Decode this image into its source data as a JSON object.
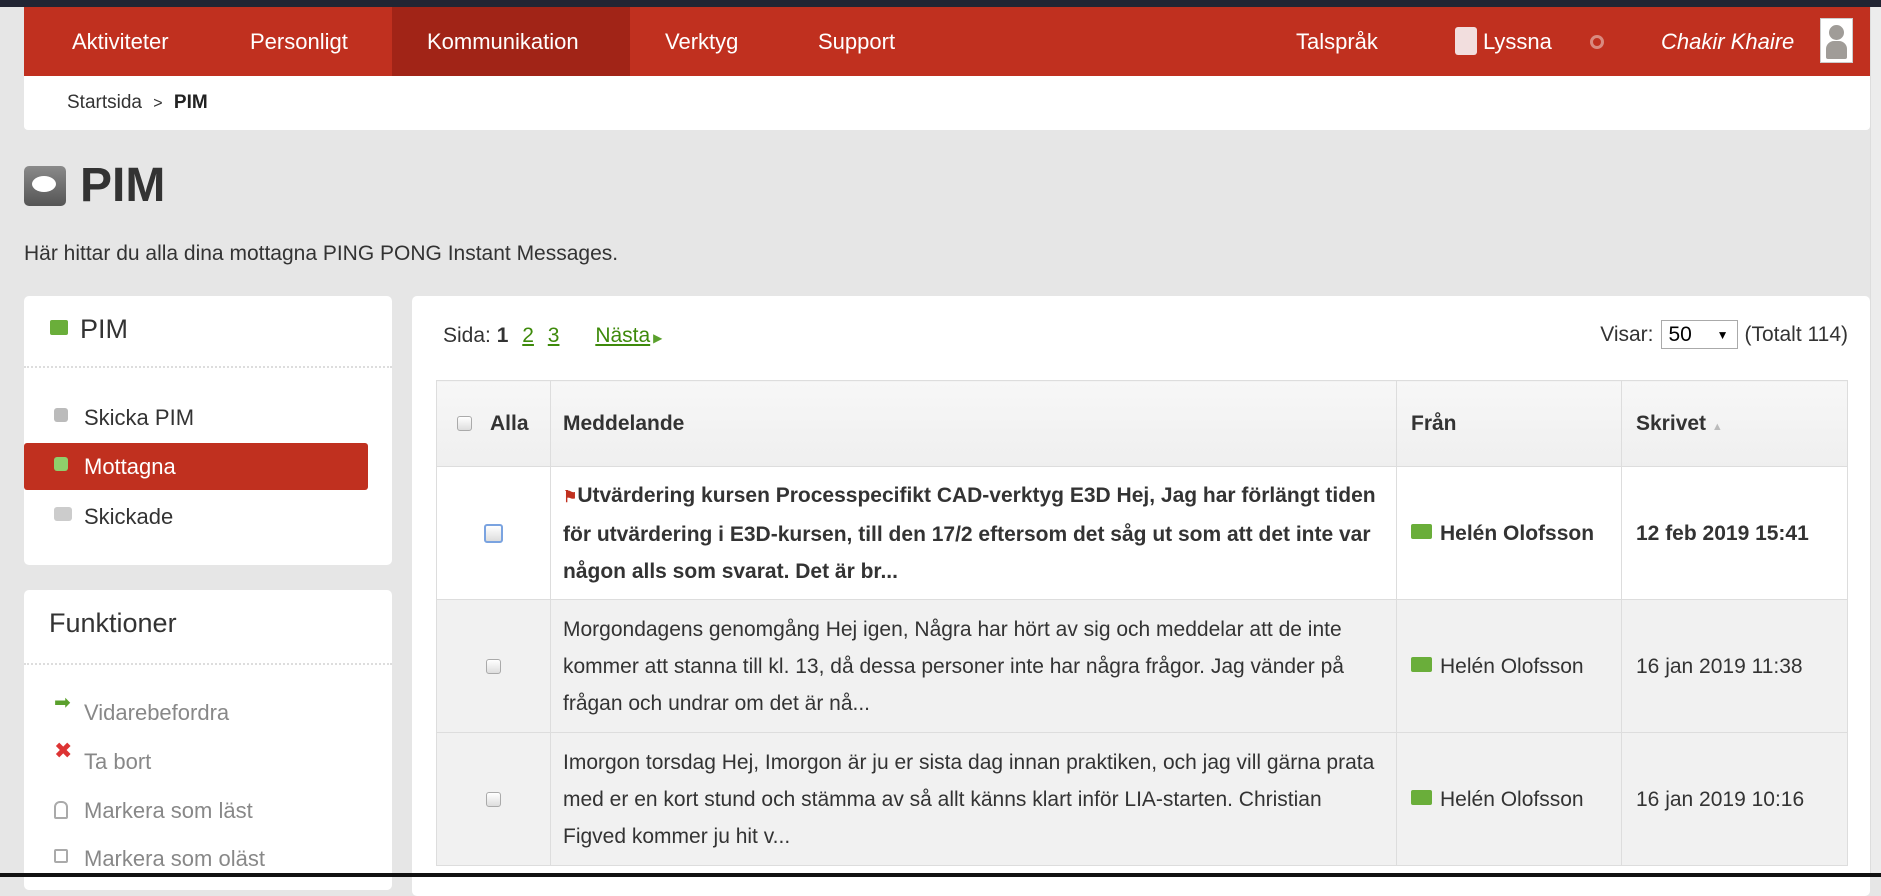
{
  "nav": {
    "items": [
      "Aktiviteter",
      "Personligt",
      "Kommunikation",
      "Verktyg",
      "Support"
    ],
    "active": "Kommunikation",
    "talsprak": "Talspråk",
    "lyssna": "Lyssna",
    "user": "Chakir Khaire"
  },
  "breadcrumb": {
    "home": "Startsida",
    "sep": ">",
    "current": "PIM"
  },
  "page": {
    "title": "PIM",
    "description": "Här hittar du alla dina mottagna PING PONG Instant Messages."
  },
  "sidebar": {
    "title": "PIM",
    "items": [
      "Skicka PIM",
      "Mottagna",
      "Skickade"
    ],
    "selected": "Mottagna"
  },
  "functions": {
    "title": "Funktioner",
    "items": [
      "Vidarebefordra",
      "Ta bort",
      "Markera som läst",
      "Markera som oläst"
    ]
  },
  "pagination": {
    "label": "Sida:",
    "current": "1",
    "pages": [
      "2",
      "3"
    ],
    "next": "Nästa"
  },
  "display": {
    "label": "Visar:",
    "value": "50",
    "total": "(Totalt 114)"
  },
  "table": {
    "headers": {
      "all": "Alla",
      "message": "Meddelande",
      "from": "Från",
      "written": "Skrivet"
    },
    "rows": [
      {
        "message": "Utvärdering kursen Processpecifikt CAD-verktyg E3D Hej, Jag har förlängt tiden för utvärdering i E3D-kursen, till den 17/2 eftersom det såg ut som att det inte var någon alls som svarat. Det är br...",
        "from": "Helén Olofsson",
        "date": "12 feb 2019 15:41",
        "unread": true
      },
      {
        "message": "Morgondagens genomgång Hej igen, Några har hört av sig och meddelar att de inte kommer att stanna till kl. 13, då dessa personer inte har några frågor. Jag vänder på frågan och undrar om det är nå...",
        "from": "Helén Olofsson",
        "date": "16 jan 2019 11:38",
        "unread": false
      },
      {
        "message": "Imorgon torsdag Hej, Imorgon är ju er sista dag innan praktiken, och jag vill gärna prata med er en kort stund och stämma av så allt känns klart inför LIA-starten. Christian Figved kommer ju hit v...",
        "from": "Helén Olofsson",
        "date": "16 jan 2019 10:16",
        "unread": false
      }
    ]
  },
  "colors": {
    "brand": "#c0301f",
    "active_tab": "#a12417",
    "link": "#3e8a0b",
    "bubble": "#6aae3a"
  }
}
